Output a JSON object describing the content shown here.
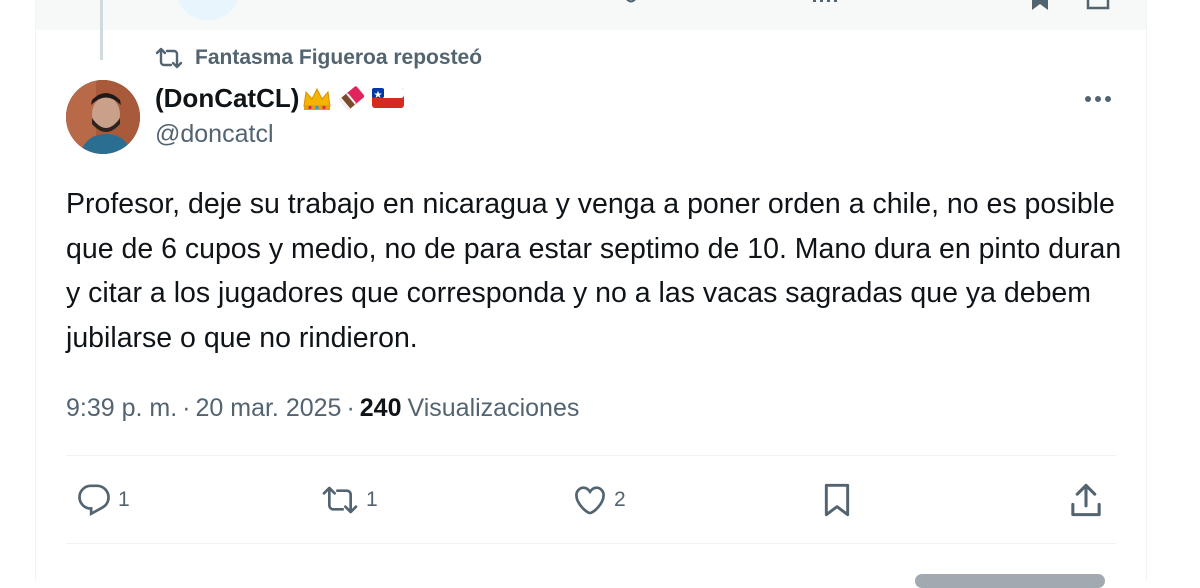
{
  "repost": {
    "label": "Fantasma Figueroa reposteó"
  },
  "author": {
    "display_name": "(DonCatCL)",
    "handle": "@doncatcl",
    "badges": [
      "crown-emoji",
      "chocolate-bar-emoji",
      "chile-flag-emoji"
    ]
  },
  "tweet": {
    "text": "Profesor, deje su trabajo en nicaragua y venga a poner orden a chile, no es posible que de 6 cupos y medio, no de para estar septimo de 10. Mano dura en pinto duran y citar a los jugadores que corresponda y no a las vacas sagradas que ya debem jubilarse o que no rindieron."
  },
  "meta": {
    "time": "9:39 p. m.",
    "separator": "·",
    "date": "20 mar. 2025",
    "views_count": "240",
    "views_label": "Visualizaciones"
  },
  "actions": {
    "reply_count": "1",
    "repost_count": "1",
    "like_count": "2"
  },
  "icons": {
    "reply": "reply-icon",
    "repost": "repost-icon",
    "like": "heart-icon",
    "bookmark": "bookmark-icon",
    "share": "share-icon",
    "more": "more-icon"
  },
  "colors": {
    "text_primary": "#0f1419",
    "text_secondary": "#536471",
    "border": "#eff3f4",
    "accent": "#1d9bf0"
  }
}
